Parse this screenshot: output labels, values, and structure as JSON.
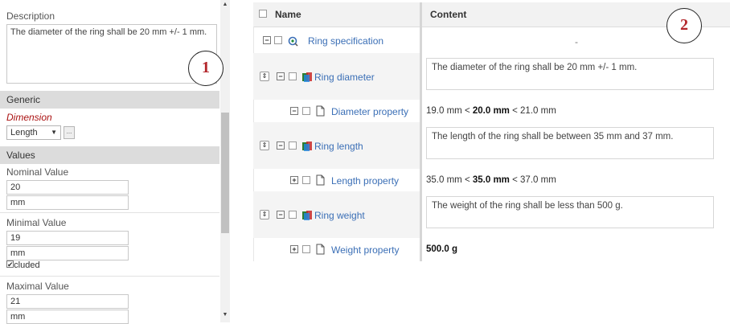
{
  "left_panel": {
    "description_label": "Description",
    "description_text": "The diameter of the ring shall be 20 mm +/- 1 mm.",
    "generic_header": "Generic",
    "dimension_label": "Dimension",
    "dimension_value": "Length",
    "dimension_button": "...",
    "values_header": "Values",
    "nominal_label": "Nominal Value",
    "nominal_value": "20",
    "nominal_unit": "mm",
    "minimal_label": "Minimal Value",
    "minimal_value": "19",
    "minimal_unit": "mm",
    "included_label": "Included",
    "maximal_label": "Maximal Value",
    "maximal_value": "21",
    "maximal_unit": "mm"
  },
  "markers": {
    "left": "1",
    "right": "2"
  },
  "tree": {
    "header": {
      "name": "Name",
      "content": "Content"
    },
    "rows": [
      {
        "name": "Ring specification",
        "content": "-"
      },
      {
        "name": "Ring diameter",
        "content": "The diameter of the ring shall be 20 mm +/- 1 mm."
      },
      {
        "name": "Diameter property",
        "min": "19.0 mm",
        "lt1": "<",
        "nominal": "20.0 mm",
        "lt2": "<",
        "max": "21.0 mm"
      },
      {
        "name": "Ring length",
        "content": "The length of the ring shall be between 35 mm and 37 mm."
      },
      {
        "name": "Length property",
        "min": "35.0 mm",
        "lt1": "<",
        "nominal": "35.0 mm",
        "lt2": "<",
        "max": "37.0 mm"
      },
      {
        "name": "Ring weight",
        "content": "The weight of the ring shall be less than 500 g."
      },
      {
        "name": "Weight property",
        "value": "500.0 g"
      }
    ]
  },
  "icons": {
    "spec": "specification-icon",
    "requirement": "requirement-icon",
    "property": "document-icon",
    "move": "move-icon"
  }
}
